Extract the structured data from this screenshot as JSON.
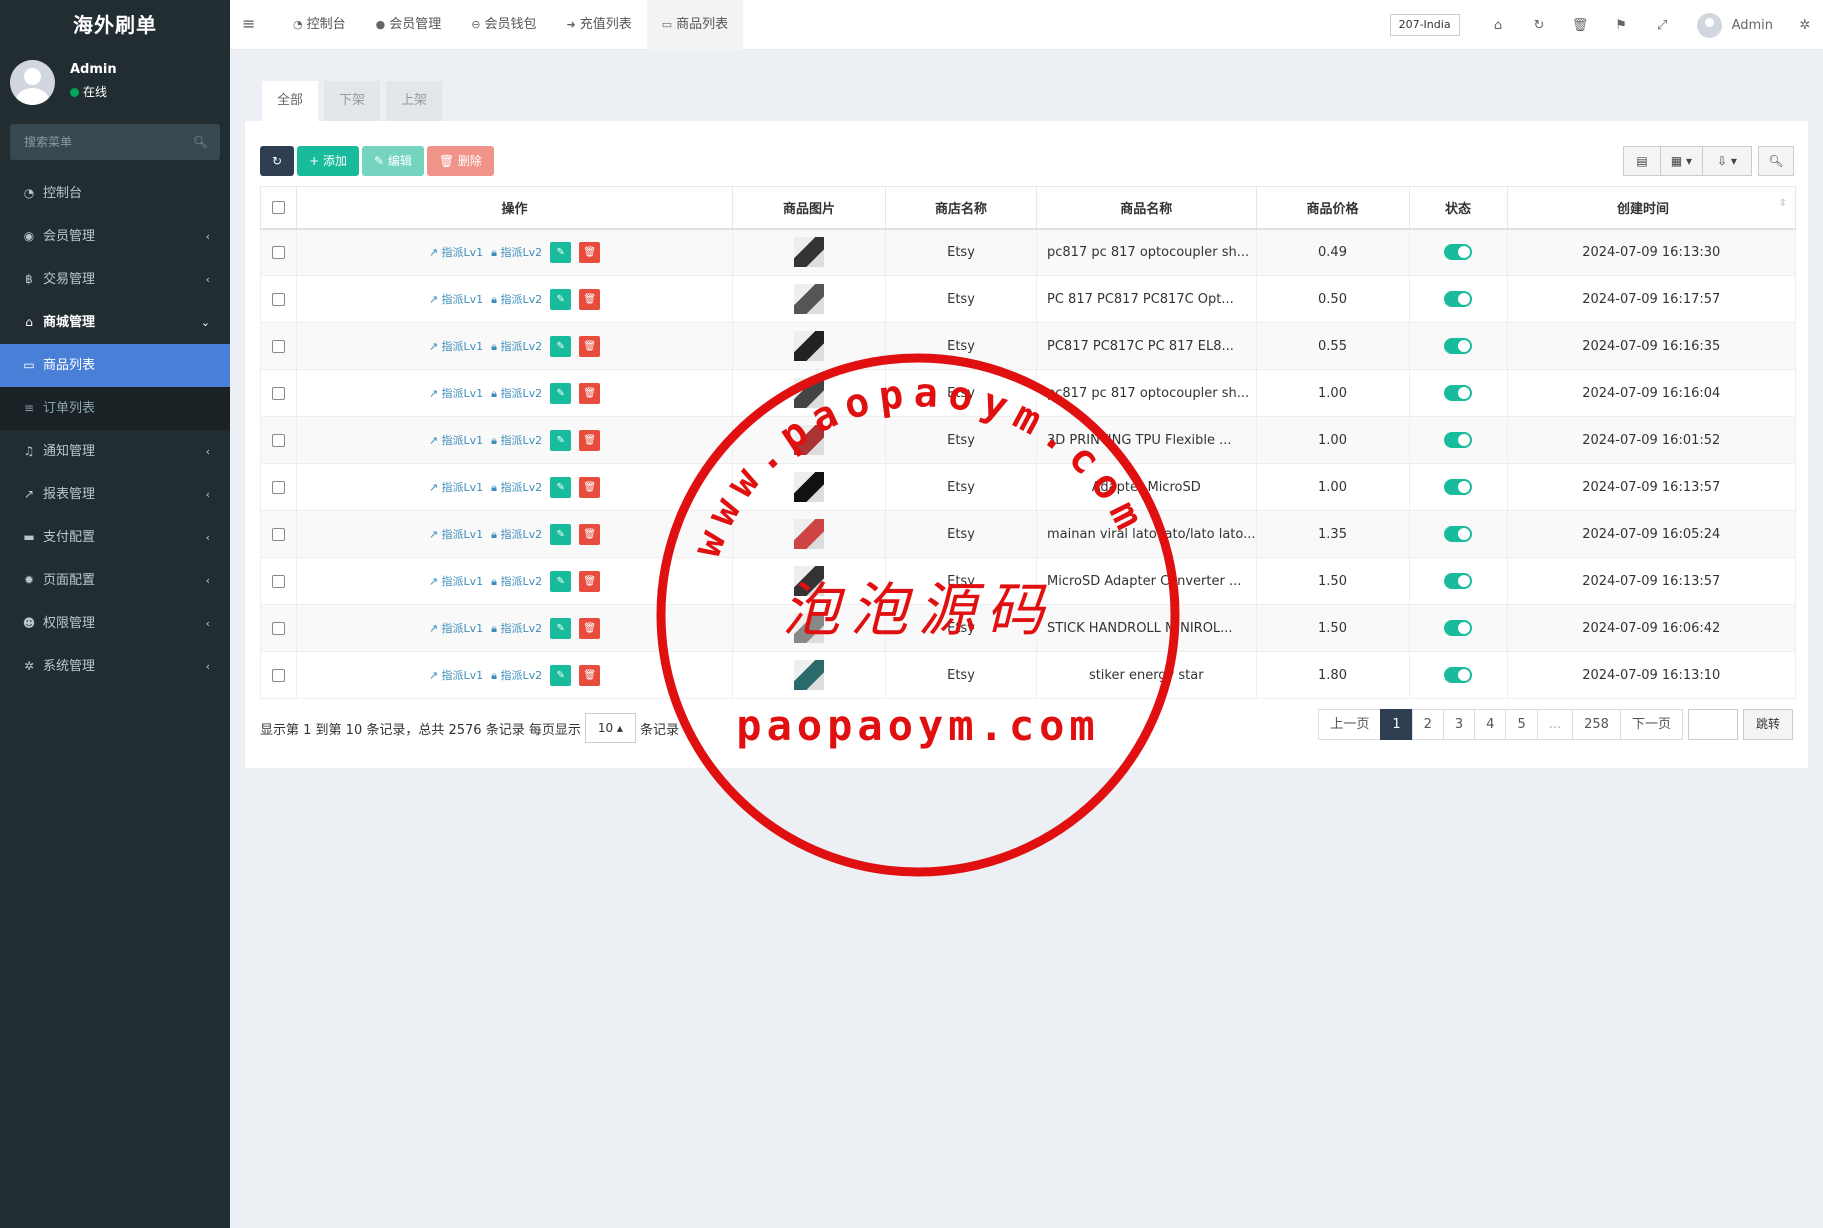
{
  "brand": "海外刷单",
  "user": {
    "name": "Admin",
    "status": "在线"
  },
  "sidebar": {
    "search_placeholder": "搜索菜单",
    "items": [
      {
        "label": "控制台",
        "icon": "dashboard-icon"
      },
      {
        "label": "会员管理",
        "icon": "user-circle-icon"
      },
      {
        "label": "交易管理",
        "icon": "bitcoin-icon"
      },
      {
        "label": "商城管理",
        "icon": "home-icon"
      },
      {
        "label": "商品列表",
        "icon": "monitor-icon"
      },
      {
        "label": "订单列表",
        "icon": "list-icon"
      },
      {
        "label": "通知管理",
        "icon": "bell-icon"
      },
      {
        "label": "报表管理",
        "icon": "chart-icon"
      },
      {
        "label": "支付配置",
        "icon": "credit-card-icon"
      },
      {
        "label": "页面配置",
        "icon": "gear-icon"
      },
      {
        "label": "权限管理",
        "icon": "users-icon"
      },
      {
        "label": "系统管理",
        "icon": "gears-icon"
      }
    ]
  },
  "header": {
    "tabs": [
      {
        "label": "控制台",
        "icon": "dashboard-icon"
      },
      {
        "label": "会员管理",
        "icon": "user-icon"
      },
      {
        "label": "会员钱包",
        "icon": "wallet-icon"
      },
      {
        "label": "充值列表",
        "icon": "sign-in-icon"
      },
      {
        "label": "商品列表",
        "icon": "monitor-icon"
      }
    ],
    "region": "207-India",
    "admin": "Admin"
  },
  "content": {
    "tabs": [
      "全部",
      "下架",
      "上架"
    ],
    "toolbar": {
      "add": "添加",
      "edit": "编辑",
      "delete": "删除"
    }
  },
  "table": {
    "headers": [
      "操作",
      "商品图片",
      "商店名称",
      "商品名称",
      "商品价格",
      "状态",
      "创建时间"
    ],
    "op_labels": {
      "lv1": "指派Lv1",
      "lv2": "指派Lv2"
    },
    "rows": [
      {
        "shop": "Etsy",
        "name": "pc817 pc 817 optocoupler sh...",
        "price": "0.49",
        "time": "2024-07-09 16:13:30"
      },
      {
        "shop": "Etsy",
        "name": "PC 817 PC817 PC817C Opt...",
        "price": "0.50",
        "time": "2024-07-09 16:17:57"
      },
      {
        "shop": "Etsy",
        "name": "PC817 PC817C PC 817 EL8...",
        "price": "0.55",
        "time": "2024-07-09 16:16:35"
      },
      {
        "shop": "Etsy",
        "name": "pc817 pc 817 optocoupler sh...",
        "price": "1.00",
        "time": "2024-07-09 16:16:04"
      },
      {
        "shop": "Etsy",
        "name": "3D PRINTING TPU Flexible ...",
        "price": "1.00",
        "time": "2024-07-09 16:01:52"
      },
      {
        "shop": "Etsy",
        "name": "Adapter MicroSD",
        "price": "1.00",
        "time": "2024-07-09 16:13:57"
      },
      {
        "shop": "Etsy",
        "name": "mainan viral lato lato/lato lato...",
        "price": "1.35",
        "time": "2024-07-09 16:05:24"
      },
      {
        "shop": "Etsy",
        "name": "MicroSD Adapter Converter ...",
        "price": "1.50",
        "time": "2024-07-09 16:13:57"
      },
      {
        "shop": "Etsy",
        "name": "STICK HANDROLL MINIROL...",
        "price": "1.50",
        "time": "2024-07-09 16:06:42"
      },
      {
        "shop": "Etsy",
        "name": "stiker energy star",
        "price": "1.80",
        "time": "2024-07-09 16:13:10"
      }
    ]
  },
  "pagination": {
    "info_prefix": "显示第 1 到第 10 条记录，总共 2576 条记录 每页显示",
    "page_size": "10",
    "info_suffix": "条记录",
    "prev": "上一页",
    "pages": [
      "1",
      "2",
      "3",
      "4",
      "5",
      "...",
      "258"
    ],
    "next": "下一页",
    "jump": "跳转"
  },
  "watermark": {
    "url": "www.paopaoym.com",
    "cn": "泡泡源码",
    "bottom": "paopaoym.com"
  }
}
